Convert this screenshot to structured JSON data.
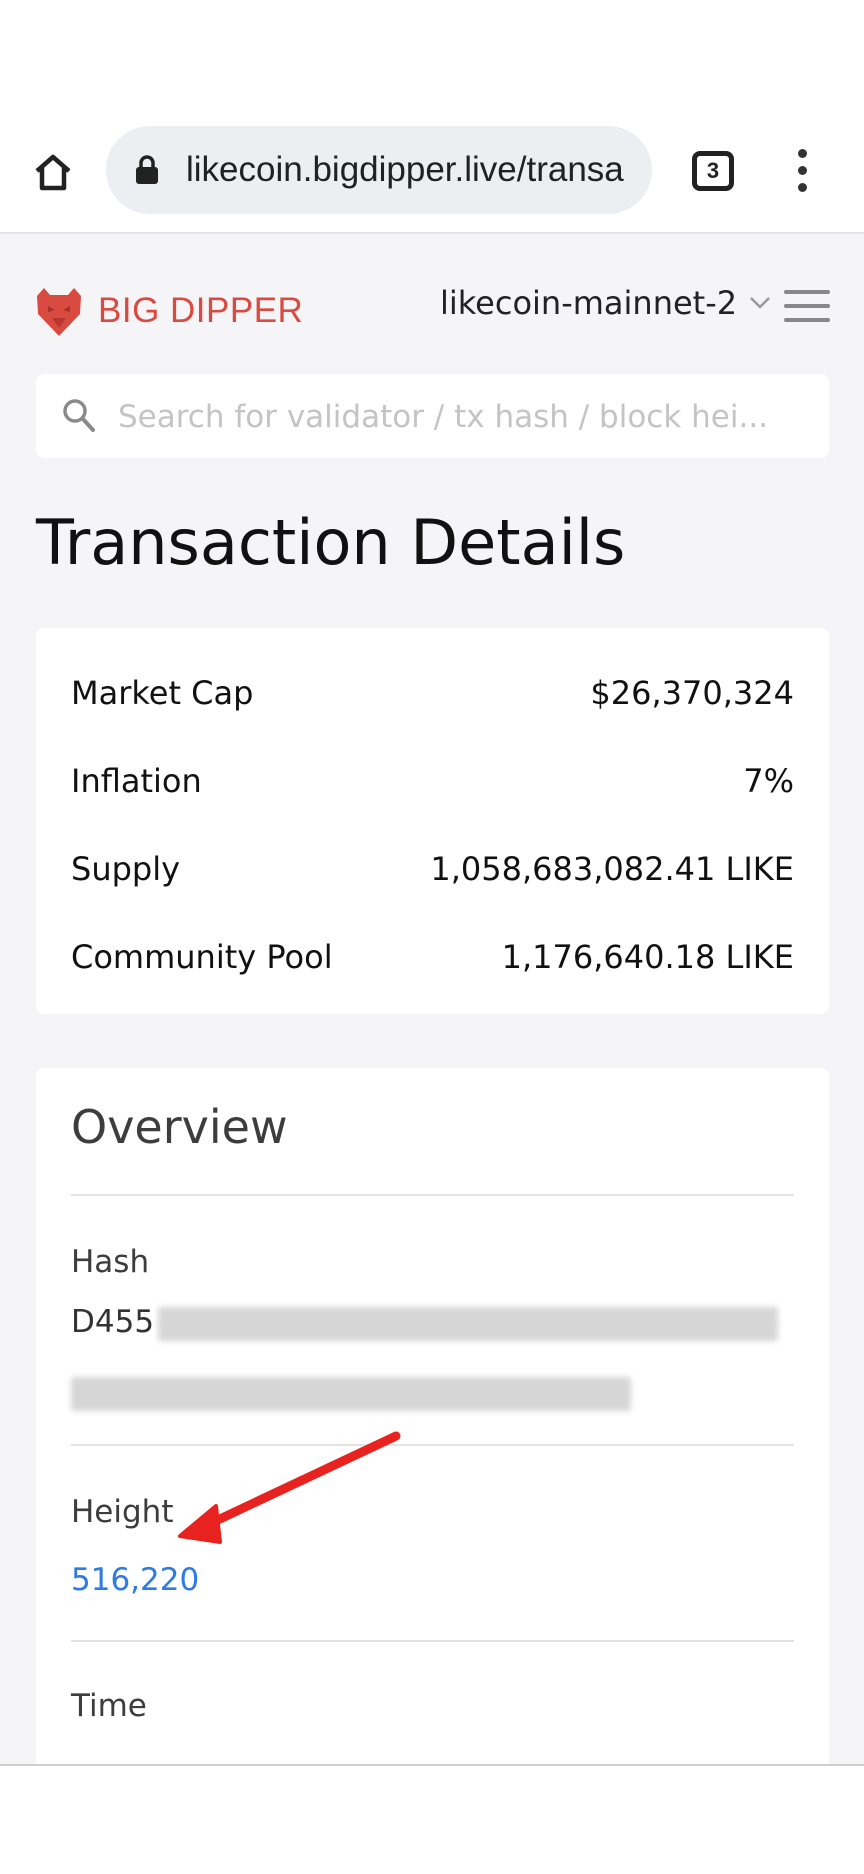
{
  "browser": {
    "url": "likecoin.bigdipper.live/transa",
    "tab_count": "3"
  },
  "header": {
    "brand": "BIG DIPPER",
    "network": "likecoin-mainnet-2"
  },
  "search": {
    "placeholder": "Search for validator / tx hash / block hei..."
  },
  "page": {
    "title": "Transaction Details"
  },
  "stats": [
    {
      "label": "Market Cap",
      "value": "$26,370,324"
    },
    {
      "label": "Inflation",
      "value": "7%"
    },
    {
      "label": "Supply",
      "value": "1,058,683,082.41 LIKE"
    },
    {
      "label": "Community Pool",
      "value": "1,176,640.18 LIKE"
    }
  ],
  "overview": {
    "title": "Overview",
    "hash_label": "Hash",
    "hash_visible": "D455",
    "height_label": "Height",
    "height_value": "516,220",
    "time_label": "Time"
  },
  "colors": {
    "brand": "#d94a40",
    "link": "#2e7be3",
    "annotation_arrow": "#e8231f"
  }
}
